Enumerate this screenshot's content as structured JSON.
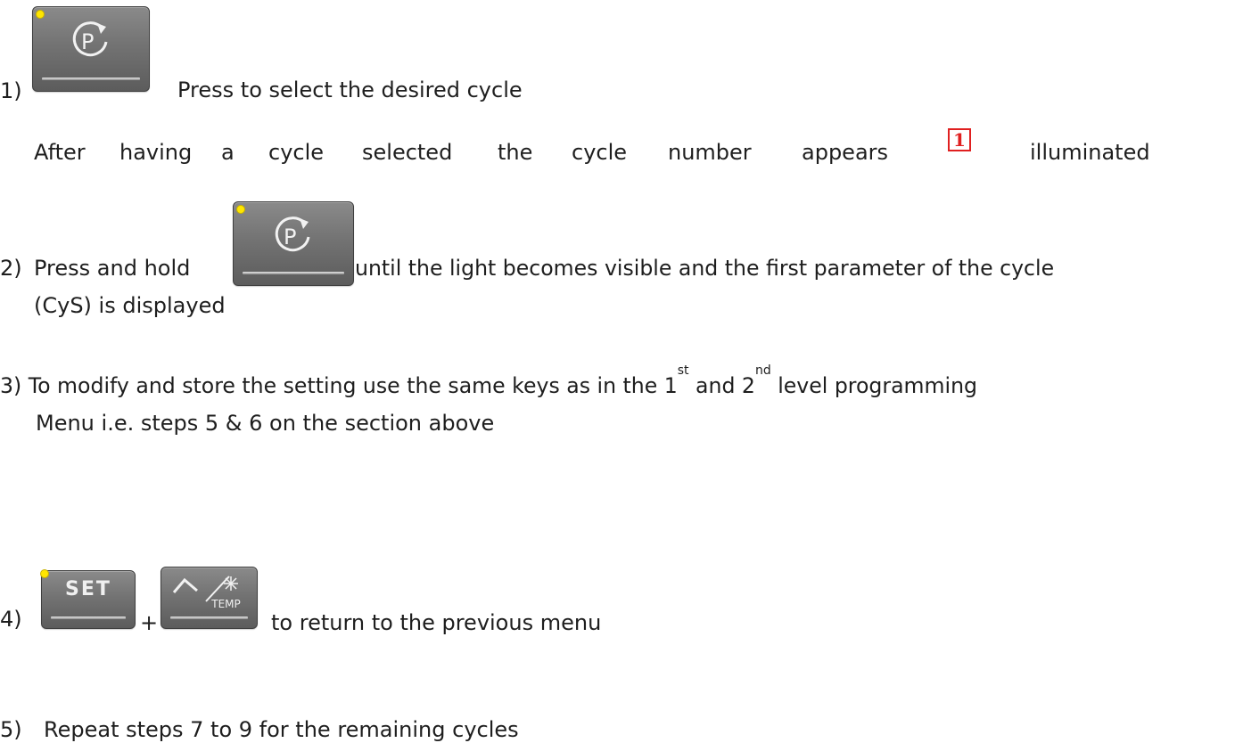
{
  "step1": {
    "number": "1)",
    "text": "Press to select the desired cycle"
  },
  "step1_note": {
    "words": [
      "After",
      "having",
      "a",
      "cycle",
      "selected",
      "the",
      "cycle",
      "number",
      "appears"
    ],
    "indicator": "1",
    "end": "illuminated"
  },
  "step2": {
    "number": "2)",
    "before": "Press and hold",
    "after": "until the light becomes visible and the first parameter of the cycle",
    "line2": "(CyS) is displayed"
  },
  "step3": {
    "number": "3)",
    "part1": "To modify and store the setting use the same keys as in the 1",
    "sup1": "st",
    "part2": " and 2",
    "sup2": "nd",
    "part3": " level programming",
    "line2": "Menu i.e. steps 5 & 6 on the section above"
  },
  "step4": {
    "number": "4)",
    "plus": "+",
    "text": "to return to the previous menu"
  },
  "step5": {
    "number": "5)",
    "text": "Repeat steps 7 to 9 for the remaining cycles"
  },
  "keys": {
    "program_key_icon": "P-cycle-arrow-icon",
    "set_key_label": "SET",
    "temp_key_label": "TEMP",
    "indicator_color": "#ffe600",
    "cycle_indicator_color": "#e02020"
  }
}
